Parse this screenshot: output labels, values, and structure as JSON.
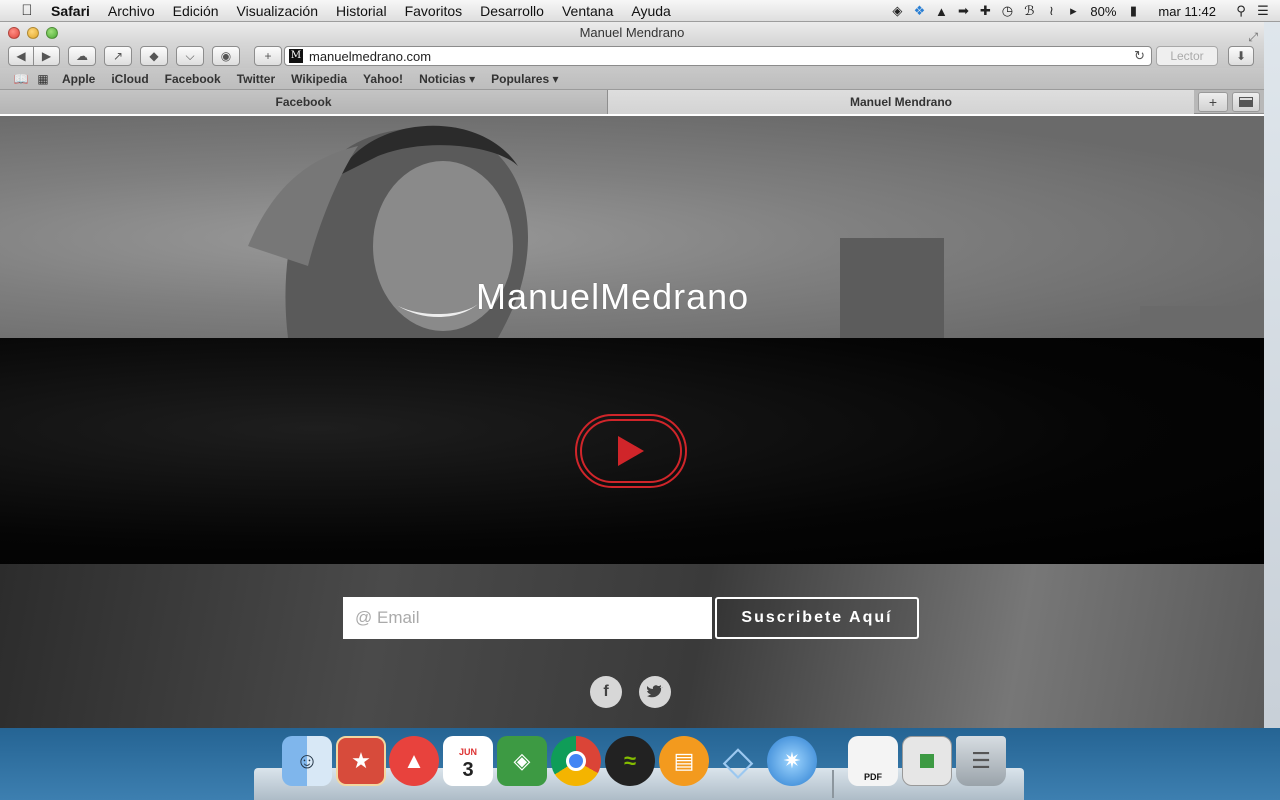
{
  "menubar": {
    "apple_icon": "apple-logo-icon",
    "app_name": "Safari",
    "menus": [
      "Archivo",
      "Edición",
      "Visualización",
      "Historial",
      "Favoritos",
      "Desarrollo",
      "Ventana",
      "Ayuda"
    ],
    "battery": "80%",
    "clock": "mar 11:42"
  },
  "window": {
    "title": "Manuel Mendrano",
    "url": "manuelmedrano.com",
    "reader_label": "Lector",
    "favicon_letter": "M"
  },
  "bookmarks": [
    "Apple",
    "iCloud",
    "Facebook",
    "Twitter",
    "Wikipedia",
    "Yahoo!",
    "Noticias ▾",
    "Populares ▾"
  ],
  "tabs": [
    {
      "label": "Facebook",
      "active": false
    },
    {
      "label": "Manuel Mendrano",
      "active": true
    }
  ],
  "page": {
    "logo": "ManuelMedrano",
    "email_placeholder": "@ Email",
    "subscribe_label": "Suscribete Aquí",
    "social": [
      "f",
      "t"
    ],
    "accent_color": "#d0252a"
  },
  "dock": {
    "apps": [
      "Finder",
      "Wunderlist",
      "Sails",
      "Calendario",
      "Evernote",
      "Chrome",
      "Spotify",
      "iBooks",
      "Sketch",
      "Safari",
      "Vista previa",
      "Ventana",
      "Papelera"
    ],
    "calendar_month": "JUN",
    "calendar_day": "3",
    "preview_label": "PDF"
  }
}
